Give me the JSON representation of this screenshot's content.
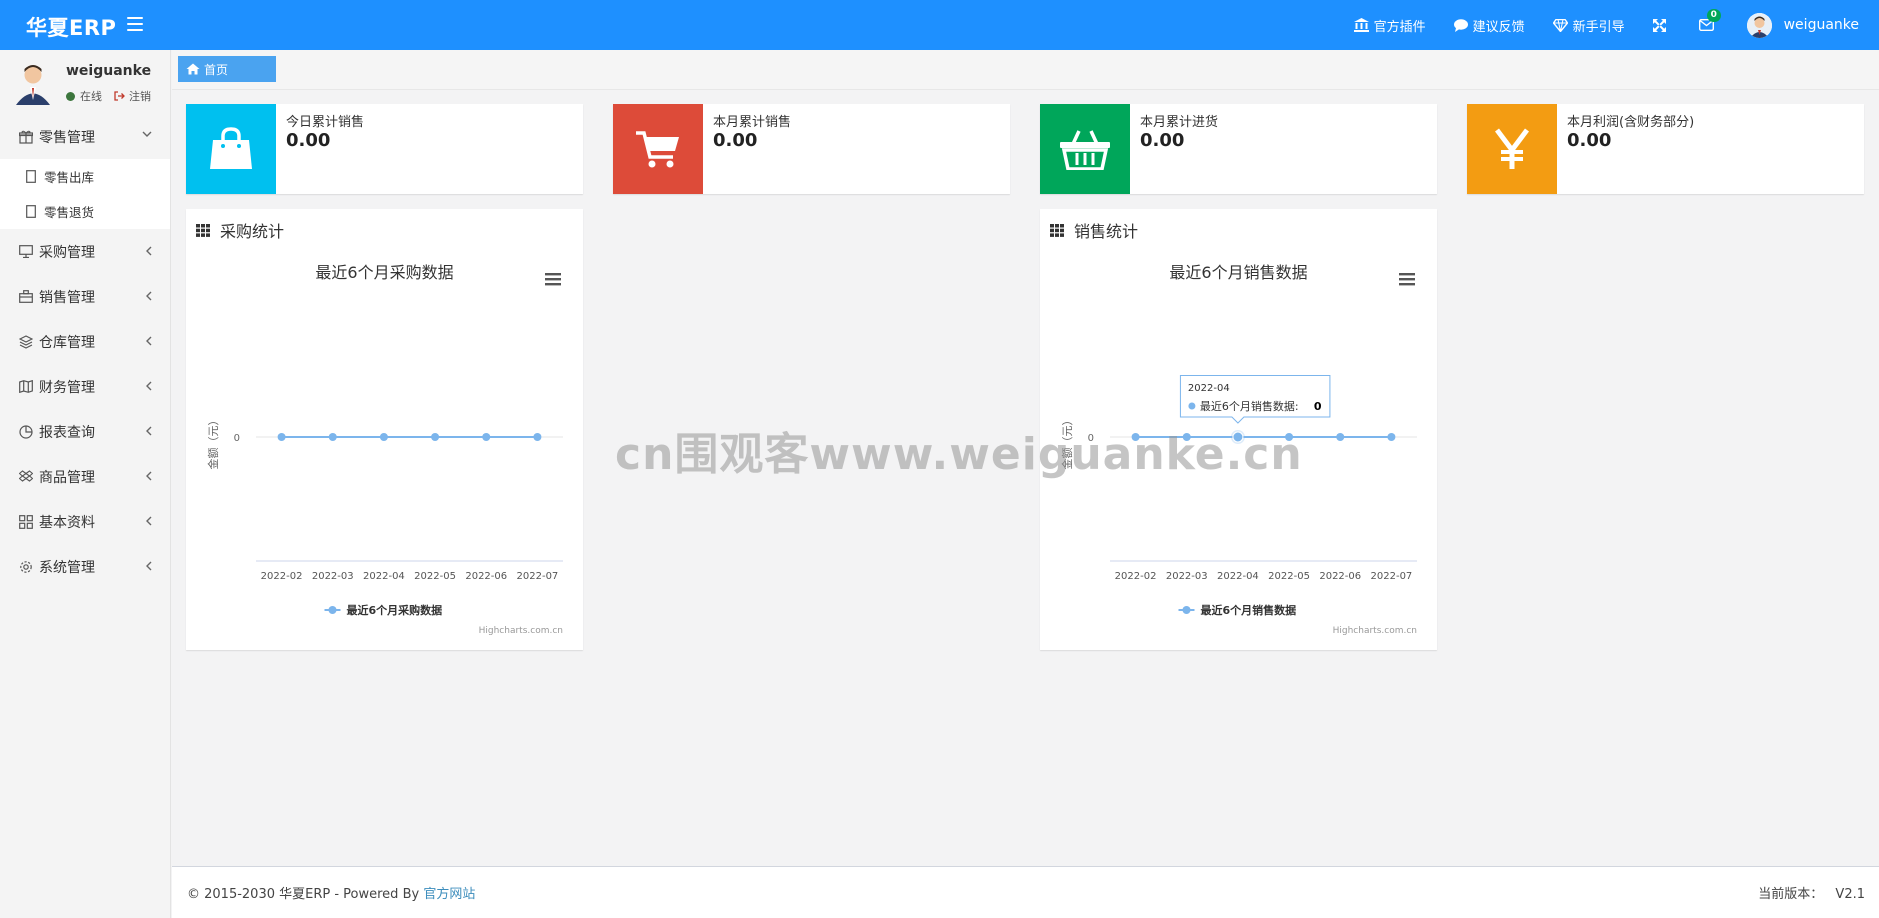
{
  "topbar": {
    "brand": "华夏ERP",
    "plugins": "官方插件",
    "feedback": "建议反馈",
    "guide": "新手引导",
    "mail_count": "0",
    "username": "weiguanke"
  },
  "sidebar": {
    "user": {
      "name": "weiguanke",
      "status": "在线",
      "logout": "注销"
    },
    "items": [
      {
        "label": "零售管理",
        "icon": "gift-icon",
        "expanded": true,
        "children": [
          {
            "label": "零售出库"
          },
          {
            "label": "零售退货"
          }
        ]
      },
      {
        "label": "采购管理",
        "icon": "desktop-icon"
      },
      {
        "label": "销售管理",
        "icon": "briefcase-icon"
      },
      {
        "label": "仓库管理",
        "icon": "layers-icon"
      },
      {
        "label": "财务管理",
        "icon": "map-icon"
      },
      {
        "label": "报表查询",
        "icon": "pie-icon"
      },
      {
        "label": "商品管理",
        "icon": "dropbox-icon"
      },
      {
        "label": "基本资料",
        "icon": "grid-icon"
      },
      {
        "label": "系统管理",
        "icon": "gear-icon"
      }
    ]
  },
  "tabs": {
    "home": "首页"
  },
  "stats": [
    {
      "label": "今日累计销售",
      "value": "0.00",
      "color": "#00c0ef",
      "icon": "shopping-bag-icon"
    },
    {
      "label": "本月累计销售",
      "value": "0.00",
      "color": "#dd4b39",
      "icon": "shopping-cart-icon"
    },
    {
      "label": "本月累计进货",
      "value": "0.00",
      "color": "#00a65a",
      "icon": "shopping-basket-icon"
    },
    {
      "label": "本月利润(含财务部分)",
      "value": "0.00",
      "color": "#f39c12",
      "icon": "yen-icon"
    }
  ],
  "panels": {
    "purchase": {
      "title": "采购统计"
    },
    "sales": {
      "title": "销售统计",
      "tooltip_x": "2022-04",
      "tooltip_label": "最近6个月销售数据:",
      "tooltip_value": "0"
    }
  },
  "chart_data": [
    {
      "type": "line",
      "title": "最近6个月采购数据",
      "ylabel": "金额（元）",
      "xlabel": "",
      "categories": [
        "2022-02",
        "2022-03",
        "2022-04",
        "2022-05",
        "2022-06",
        "2022-07"
      ],
      "yticks": [
        "0"
      ],
      "series": [
        {
          "name": "最近6个月采购数据",
          "values": [
            0,
            0,
            0,
            0,
            0,
            0
          ]
        }
      ],
      "credits": "Highcharts.com.cn",
      "legend": "bottom-center",
      "color": "#7cb5ec"
    },
    {
      "type": "line",
      "title": "最近6个月销售数据",
      "ylabel": "金额（元）",
      "xlabel": "",
      "categories": [
        "2022-02",
        "2022-03",
        "2022-04",
        "2022-05",
        "2022-06",
        "2022-07"
      ],
      "yticks": [
        "0"
      ],
      "series": [
        {
          "name": "最近6个月销售数据",
          "values": [
            0,
            0,
            0,
            0,
            0,
            0
          ]
        }
      ],
      "credits": "Highcharts.com.cn",
      "legend": "bottom-center",
      "color": "#7cb5ec"
    }
  ],
  "watermark": "cn围观客www.weiguanke.cn",
  "footer": {
    "copyright": "© 2015-2030 华夏ERP - Powered By",
    "link": "官方网站",
    "version_label": "当前版本：",
    "version": "V2.1"
  }
}
